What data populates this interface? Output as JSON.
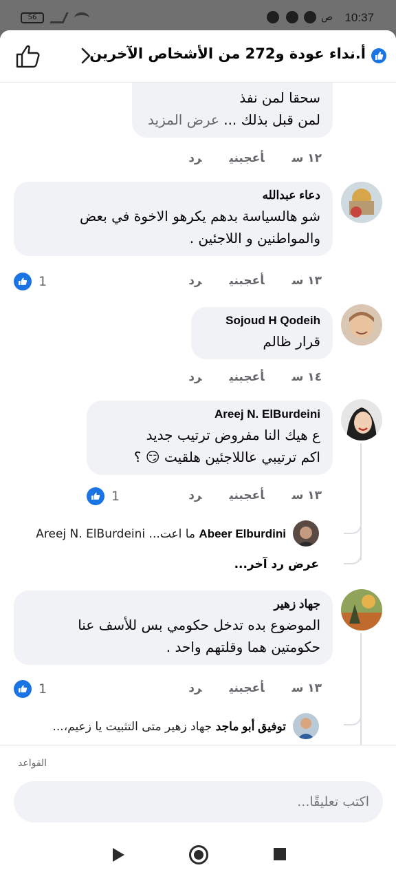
{
  "status_bar": {
    "time": "10:37",
    "ampm": "ص",
    "battery": "56"
  },
  "header": {
    "title": "أ.نداء عودة و272 من الأشخاص الآخرين"
  },
  "comments": [
    {
      "text_line1": "سحقا لمن نفذ",
      "text_line2": "لمن قبل بذلك ...",
      "see_more": "عرض المزيد",
      "time": "١٢ س",
      "like": "أعجبني",
      "reply": "رد"
    },
    {
      "name": "دعاء عبدالله",
      "text_line1": "شو هالسياسة بدهم يكرهو الاخوة في بعض",
      "text_line2": "والمواطنين و اللاجئين .",
      "time": "١٣ س",
      "like": "أعجبني",
      "reply": "رد",
      "reactions": "1"
    },
    {
      "name": "Sojoud H Qodeih",
      "text_line1": "قرار ظالم",
      "time": "١٤ س",
      "like": "أعجبني",
      "reply": "رد"
    },
    {
      "name": "Areej N. ElBurdeini",
      "text_line1": "ع هيك النا مفروض ترتيب جديد",
      "text_line2": "اكم ترتيبي عاللاجئين هلقيت 😏 ؟",
      "time": "١٣ س",
      "like": "أعجبني",
      "reply": "رد",
      "reactions": "1",
      "reply_preview": {
        "name": "Abeer Elburdini",
        "text": "ما اعت... Areej N. ElBurdeini"
      },
      "more_replies": "عرض رد آخر..."
    },
    {
      "name": "جهاد زهير",
      "text_line1": "الموضوع بده تدخل حكومي بس للأسف عنا",
      "text_line2": "حكومتين هما وقلتهم واحد .",
      "time": "١٣ س",
      "like": "أعجبني",
      "reply": "رد",
      "reactions": "1",
      "reply_preview": {
        "name": "توفيق أبو ماجد",
        "text": "جهاد زهير متى التثبيت يا زعيم،..."
      }
    }
  ],
  "composer": {
    "rules": "القواعد",
    "placeholder": "اكتب تعليقًا..."
  }
}
